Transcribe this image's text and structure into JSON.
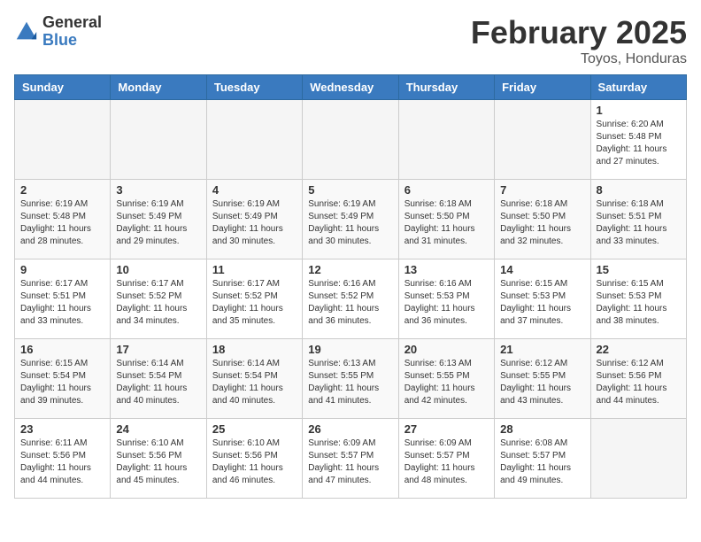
{
  "header": {
    "logo_general": "General",
    "logo_blue": "Blue",
    "month_title": "February 2025",
    "subtitle": "Toyos, Honduras"
  },
  "days_of_week": [
    "Sunday",
    "Monday",
    "Tuesday",
    "Wednesday",
    "Thursday",
    "Friday",
    "Saturday"
  ],
  "weeks": [
    [
      {
        "day": "",
        "info": ""
      },
      {
        "day": "",
        "info": ""
      },
      {
        "day": "",
        "info": ""
      },
      {
        "day": "",
        "info": ""
      },
      {
        "day": "",
        "info": ""
      },
      {
        "day": "",
        "info": ""
      },
      {
        "day": "1",
        "info": "Sunrise: 6:20 AM\nSunset: 5:48 PM\nDaylight: 11 hours and 27 minutes."
      }
    ],
    [
      {
        "day": "2",
        "info": "Sunrise: 6:19 AM\nSunset: 5:48 PM\nDaylight: 11 hours and 28 minutes."
      },
      {
        "day": "3",
        "info": "Sunrise: 6:19 AM\nSunset: 5:49 PM\nDaylight: 11 hours and 29 minutes."
      },
      {
        "day": "4",
        "info": "Sunrise: 6:19 AM\nSunset: 5:49 PM\nDaylight: 11 hours and 30 minutes."
      },
      {
        "day": "5",
        "info": "Sunrise: 6:19 AM\nSunset: 5:49 PM\nDaylight: 11 hours and 30 minutes."
      },
      {
        "day": "6",
        "info": "Sunrise: 6:18 AM\nSunset: 5:50 PM\nDaylight: 11 hours and 31 minutes."
      },
      {
        "day": "7",
        "info": "Sunrise: 6:18 AM\nSunset: 5:50 PM\nDaylight: 11 hours and 32 minutes."
      },
      {
        "day": "8",
        "info": "Sunrise: 6:18 AM\nSunset: 5:51 PM\nDaylight: 11 hours and 33 minutes."
      }
    ],
    [
      {
        "day": "9",
        "info": "Sunrise: 6:17 AM\nSunset: 5:51 PM\nDaylight: 11 hours and 33 minutes."
      },
      {
        "day": "10",
        "info": "Sunrise: 6:17 AM\nSunset: 5:52 PM\nDaylight: 11 hours and 34 minutes."
      },
      {
        "day": "11",
        "info": "Sunrise: 6:17 AM\nSunset: 5:52 PM\nDaylight: 11 hours and 35 minutes."
      },
      {
        "day": "12",
        "info": "Sunrise: 6:16 AM\nSunset: 5:52 PM\nDaylight: 11 hours and 36 minutes."
      },
      {
        "day": "13",
        "info": "Sunrise: 6:16 AM\nSunset: 5:53 PM\nDaylight: 11 hours and 36 minutes."
      },
      {
        "day": "14",
        "info": "Sunrise: 6:15 AM\nSunset: 5:53 PM\nDaylight: 11 hours and 37 minutes."
      },
      {
        "day": "15",
        "info": "Sunrise: 6:15 AM\nSunset: 5:53 PM\nDaylight: 11 hours and 38 minutes."
      }
    ],
    [
      {
        "day": "16",
        "info": "Sunrise: 6:15 AM\nSunset: 5:54 PM\nDaylight: 11 hours and 39 minutes."
      },
      {
        "day": "17",
        "info": "Sunrise: 6:14 AM\nSunset: 5:54 PM\nDaylight: 11 hours and 40 minutes."
      },
      {
        "day": "18",
        "info": "Sunrise: 6:14 AM\nSunset: 5:54 PM\nDaylight: 11 hours and 40 minutes."
      },
      {
        "day": "19",
        "info": "Sunrise: 6:13 AM\nSunset: 5:55 PM\nDaylight: 11 hours and 41 minutes."
      },
      {
        "day": "20",
        "info": "Sunrise: 6:13 AM\nSunset: 5:55 PM\nDaylight: 11 hours and 42 minutes."
      },
      {
        "day": "21",
        "info": "Sunrise: 6:12 AM\nSunset: 5:55 PM\nDaylight: 11 hours and 43 minutes."
      },
      {
        "day": "22",
        "info": "Sunrise: 6:12 AM\nSunset: 5:56 PM\nDaylight: 11 hours and 44 minutes."
      }
    ],
    [
      {
        "day": "23",
        "info": "Sunrise: 6:11 AM\nSunset: 5:56 PM\nDaylight: 11 hours and 44 minutes."
      },
      {
        "day": "24",
        "info": "Sunrise: 6:10 AM\nSunset: 5:56 PM\nDaylight: 11 hours and 45 minutes."
      },
      {
        "day": "25",
        "info": "Sunrise: 6:10 AM\nSunset: 5:56 PM\nDaylight: 11 hours and 46 minutes."
      },
      {
        "day": "26",
        "info": "Sunrise: 6:09 AM\nSunset: 5:57 PM\nDaylight: 11 hours and 47 minutes."
      },
      {
        "day": "27",
        "info": "Sunrise: 6:09 AM\nSunset: 5:57 PM\nDaylight: 11 hours and 48 minutes."
      },
      {
        "day": "28",
        "info": "Sunrise: 6:08 AM\nSunset: 5:57 PM\nDaylight: 11 hours and 49 minutes."
      },
      {
        "day": "",
        "info": ""
      }
    ]
  ]
}
